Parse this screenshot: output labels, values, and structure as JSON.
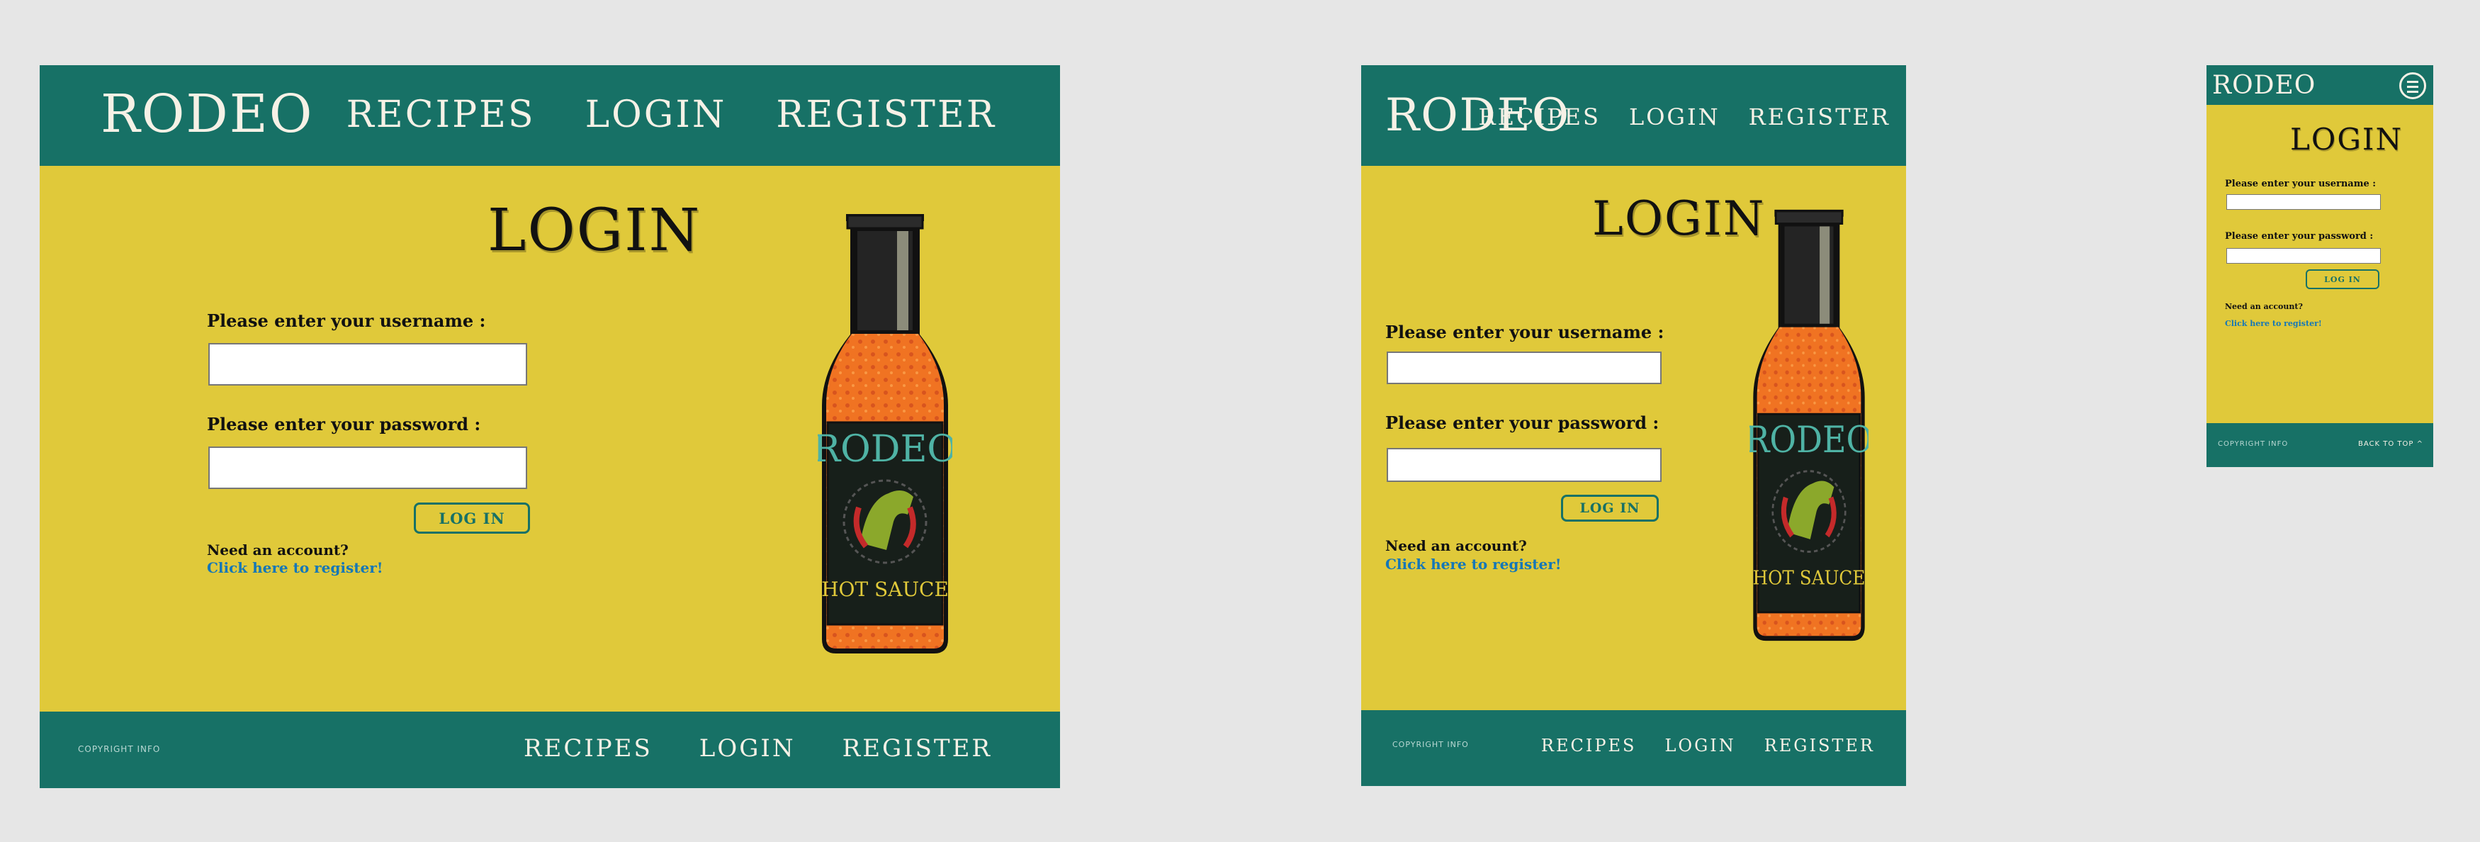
{
  "colors": {
    "page_bg": "#e6e6e6",
    "content_bg": "#e0c93a",
    "header_bg": "#177166",
    "header_text": "#f6f1e6",
    "link": "#1577b7",
    "button_border": "#177166"
  },
  "brand": {
    "name": "RODEO"
  },
  "nav": {
    "recipes": "RECIPES",
    "login": "LOGIN",
    "register": "REGISTER"
  },
  "page": {
    "title": "LOGIN"
  },
  "form": {
    "username_label": "Please enter your username :",
    "username_value": "",
    "password_label": "Please enter your password :",
    "password_value": "",
    "submit_label": "LOG IN"
  },
  "signup": {
    "prompt": "Need an account?",
    "link_text": "Click here to register!"
  },
  "footer": {
    "copyright": "COPYRIGHT INFO",
    "back_to_top": "BACK TO TOP ^"
  },
  "bottle": {
    "label_brand": "RODEO",
    "label_product": "HOT SAUCE"
  },
  "icons": [
    "hamburger-menu-icon",
    "hot-sauce-bottle-icon"
  ]
}
